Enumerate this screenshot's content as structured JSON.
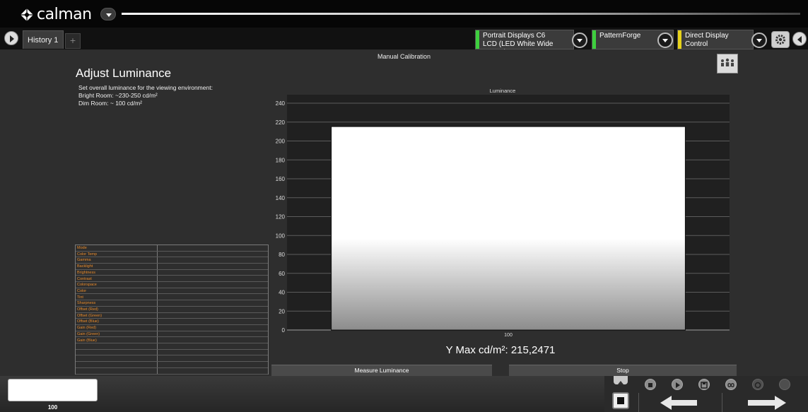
{
  "app": {
    "logo_text": "calman"
  },
  "tabs": [
    {
      "label": "History 1"
    },
    {
      "label": "+"
    }
  ],
  "devices": [
    {
      "line1": "Portrait Displays C6",
      "line2": "LCD (LED White Wide Gamut)",
      "status_color": "#3ecf3e"
    },
    {
      "line1": "PatternForge",
      "line2": "",
      "status_color": "#3ecf3e"
    },
    {
      "line1": "Direct Display Control",
      "line2": "",
      "status_color": "#e6d21a"
    }
  ],
  "panel": {
    "title": "Manual Calibration",
    "heading": "Adjust Luminance",
    "description": [
      "Set overall luminance for the viewing environment:",
      "Bright Room: ~230-250 cd/m²",
      "Dim Room: ~ 100 cd/m²"
    ]
  },
  "settings_rows": [
    "Mode",
    "Color Temp",
    "Gamma",
    "Backlight",
    "Brightness",
    "Contrast",
    "Colorspace",
    "Color",
    "Tint",
    "Sharpness",
    "Offset (Red)",
    "Offset (Green)",
    "Offset (Blue)",
    "Gain (Red)",
    "Gain (Green)",
    "Gain (Blue)",
    "",
    "",
    "",
    "",
    ""
  ],
  "chart_data": {
    "type": "bar",
    "title": "Luminance",
    "categories": [
      "100"
    ],
    "values": [
      215.2471
    ],
    "ylim": [
      0,
      250
    ],
    "yticks": [
      0,
      20,
      40,
      60,
      80,
      100,
      120,
      140,
      160,
      180,
      200,
      220,
      240
    ],
    "grid": true
  },
  "readout": {
    "text": "Y Max cd/m²: 215,2471"
  },
  "actions": {
    "measure": "Measure Luminance",
    "stop": "Stop"
  },
  "swatch": {
    "label": "100",
    "color": "#ffffff"
  },
  "colors": {
    "accent_orange": "#e88a2a",
    "background": "#2e2e2e"
  }
}
